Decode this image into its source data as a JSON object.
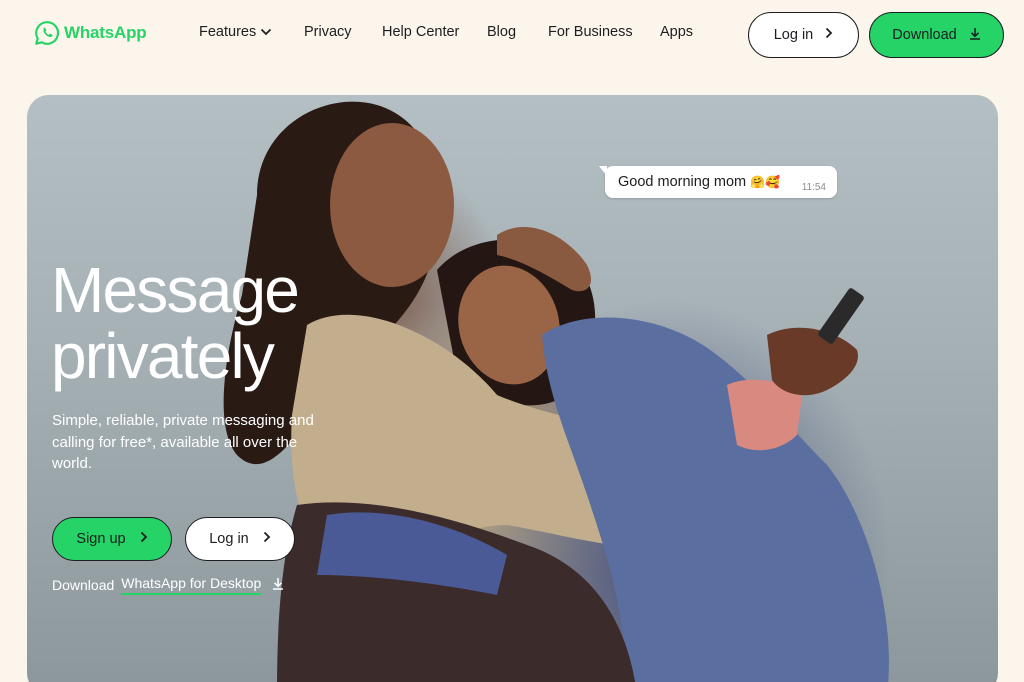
{
  "brand": {
    "name": "WhatsApp",
    "color": "#25d366"
  },
  "nav": {
    "links": [
      {
        "label": "Features",
        "has_dropdown": true
      },
      {
        "label": "Privacy"
      },
      {
        "label": "Help Center"
      },
      {
        "label": "Blog"
      },
      {
        "label": "For Business"
      },
      {
        "label": "Apps"
      }
    ],
    "login_label": "Log in",
    "download_label": "Download"
  },
  "hero": {
    "chat": {
      "message": "Good morning mom",
      "emojis": "🤗🥰",
      "time": "11:54"
    },
    "title_line1": "Message",
    "title_line2": "privately",
    "subtitle": "Simple, reliable, private messaging and calling for free*, available all over the world.",
    "signup_label": "Sign up",
    "login_label": "Log in",
    "desktop_prefix": "Download",
    "desktop_link": "WhatsApp for Desktop"
  },
  "colors": {
    "background": "#fcf5eb",
    "accent": "#25d366",
    "text": "#1c1e21"
  },
  "icons": [
    "whatsapp-logo-icon",
    "chevron-down-icon",
    "chevron-right-icon",
    "download-icon"
  ]
}
